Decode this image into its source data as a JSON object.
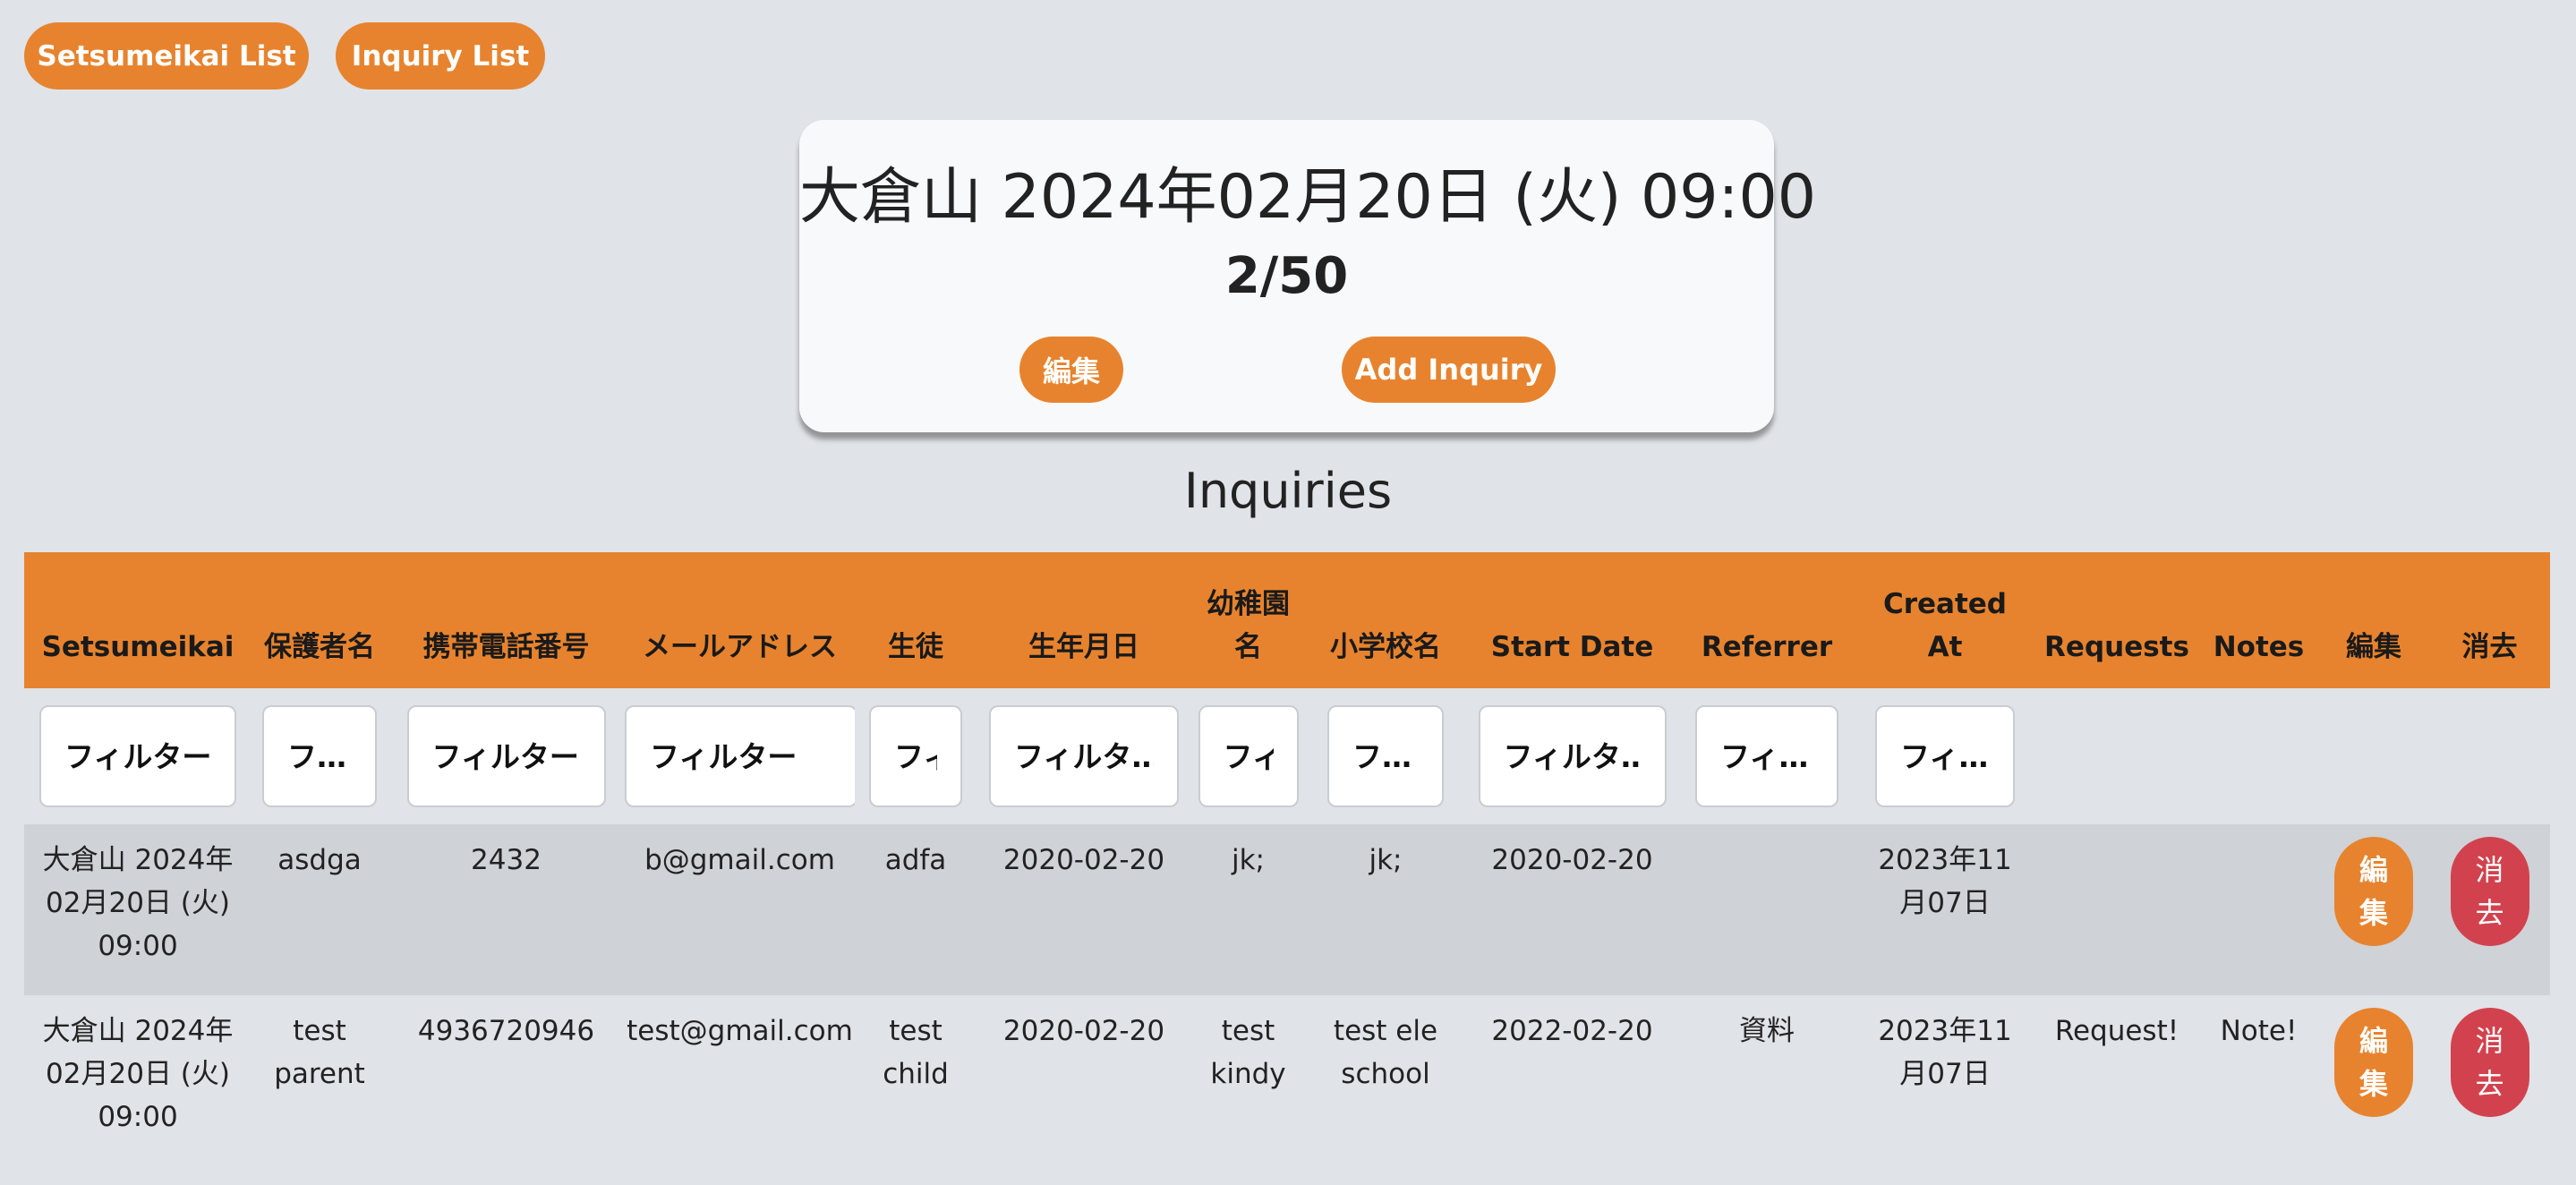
{
  "nav": {
    "setsumeikai_list_label": "Setsumeikai List",
    "inquiry_list_label": "Inquiry List"
  },
  "event_card": {
    "title": "大倉山 2024年02月20日 (火) 09:00",
    "count": "2/50",
    "edit_label": "編集",
    "add_inquiry_label": "Add Inquiry"
  },
  "inquiries": {
    "title": "Inquiries",
    "headers": {
      "setsumeikai": "Setsumeikai",
      "guardian_name": "保護者名",
      "mobile": "携帯電話番号",
      "email": "メールアドレス",
      "student": "生徒",
      "birthdate": "生年月日",
      "kindergarten_line1": "幼稚園",
      "kindergarten_line2": "名",
      "elementary": "小学校名",
      "start_date": "Start Date",
      "referrer": "Referrer",
      "created_line1": "Created",
      "created_line2": "At",
      "requests": "Requests",
      "notes": "Notes",
      "edit": "編集",
      "delete": "消去"
    },
    "filters": {
      "setsumeikai": "フィルター",
      "guardian_name": "フ…",
      "mobile": "フィルター",
      "email": "フィルター",
      "student": "フィル",
      "birthdate": "フィルタ…",
      "kindergarten": "フィル",
      "elementary": "フ…",
      "start_date": "フィルタ…",
      "referrer": "フィ…",
      "created": "フィ…"
    },
    "rows": [
      {
        "setsumeikai_l1": "大倉山 2024年",
        "setsumeikai_l2": "02月20日 (火)",
        "setsumeikai_l3": "09:00",
        "guardian_l1": "asdga",
        "guardian_l2": "",
        "mobile": "2432",
        "email": "b@gmail.com",
        "student_l1": "adfa",
        "student_l2": "",
        "birthdate": "2020-02-20",
        "kindergarten_l1": "jk;",
        "kindergarten_l2": "",
        "elementary_l1": "jk;",
        "elementary_l2": "",
        "start_date": "2020-02-20",
        "referrer": "",
        "created_l1": "2023年11",
        "created_l2": "月07日",
        "requests": "",
        "notes": "",
        "edit_l1": "編",
        "edit_l2": "集",
        "delete_l1": "消",
        "delete_l2": "去"
      },
      {
        "setsumeikai_l1": "大倉山 2024年",
        "setsumeikai_l2": "02月20日 (火)",
        "setsumeikai_l3": "09:00",
        "guardian_l1": "test",
        "guardian_l2": "parent",
        "mobile": "4936720946",
        "email": "test@gmail.com",
        "student_l1": "test",
        "student_l2": "child",
        "birthdate": "2020-02-20",
        "kindergarten_l1": "test",
        "kindergarten_l2": "kindy",
        "elementary_l1": "test ele",
        "elementary_l2": "school",
        "start_date": "2022-02-20",
        "referrer": "資料",
        "created_l1": "2023年11",
        "created_l2": "月07日",
        "requests": "Request!",
        "notes": "Note!",
        "edit_l1": "編",
        "edit_l2": "集",
        "delete_l1": "消",
        "delete_l2": "去"
      }
    ]
  },
  "colors": {
    "accent": "#e7832e",
    "danger": "#d2424e",
    "background": "#e0e3e7",
    "row_alt": "#cfd2d7"
  }
}
